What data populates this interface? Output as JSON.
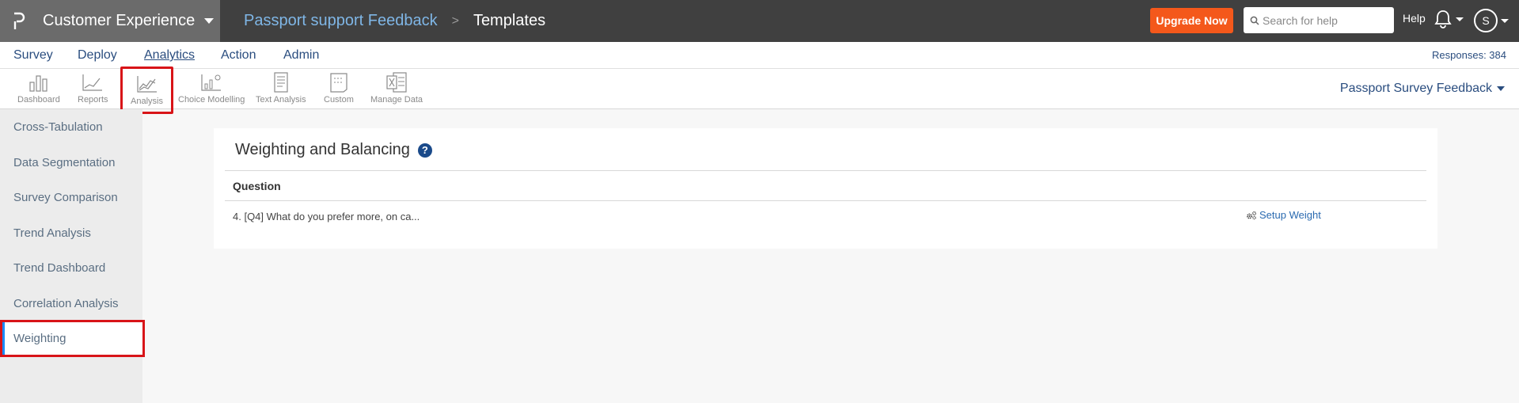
{
  "header": {
    "product": "Customer Experience",
    "survey_name": "Passport support Feedback",
    "breadcrumb_separator": ">",
    "page": "Templates",
    "upgrade_label": "Upgrade Now",
    "search_placeholder": "Search for help",
    "help_label": "Help",
    "avatar_initial": "S",
    "logo_icon": "questionpro-logo-icon",
    "bell_icon": "bell-icon"
  },
  "menu": {
    "items": [
      "Survey",
      "Deploy",
      "Analytics",
      "Action",
      "Admin"
    ],
    "active": "Analytics",
    "responses": "Responses: 384"
  },
  "toolbar": {
    "tools": [
      {
        "label": "Dashboard",
        "icon": "bar-chart-icon"
      },
      {
        "label": "Reports",
        "icon": "line-chart-icon"
      },
      {
        "label": "Analysis",
        "icon": "analysis-icon"
      },
      {
        "label": "Choice Modelling",
        "icon": "choice-modelling-icon"
      },
      {
        "label": "Text Analysis",
        "icon": "text-analysis-icon"
      },
      {
        "label": "Custom",
        "icon": "custom-icon"
      },
      {
        "label": "Manage Data",
        "icon": "excel-icon"
      }
    ],
    "survey_switch": "Passport Survey Feedback"
  },
  "sidebar": {
    "items": [
      {
        "label": "Cross-Tabulation"
      },
      {
        "label": "Data Segmentation"
      },
      {
        "label": "Survey Comparison"
      },
      {
        "label": "Trend Analysis"
      },
      {
        "label": "Trend Dashboard"
      },
      {
        "label": "Correlation Analysis"
      },
      {
        "label": "Weighting"
      }
    ],
    "active": "Weighting"
  },
  "main": {
    "title": "Weighting and Balancing",
    "help_icon": "question-circle-icon",
    "table": {
      "header": "Question",
      "rows": [
        {
          "question": "4. [Q4] What do you prefer more, on ca...",
          "action": "Setup Weight",
          "action_icon": "gears-icon"
        }
      ]
    }
  },
  "colors": {
    "topbar": "#404040",
    "brand_bg": "#6b6b6b",
    "accent_link": "#2a4d7f",
    "upgrade": "#f4581b",
    "highlight": "#d81418",
    "active_sidebar": "#1a8cff"
  }
}
